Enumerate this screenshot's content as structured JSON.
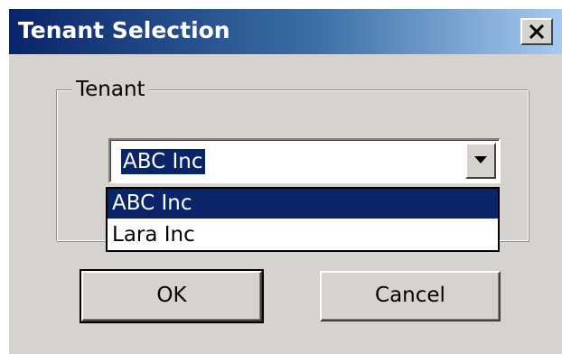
{
  "window": {
    "title": "Tenant Selection",
    "close_label": "close",
    "titlebar_colors": [
      "#0a246a",
      "#a6caf0"
    ],
    "background": "#d6d3ce"
  },
  "group": {
    "legend": "Tenant"
  },
  "combo": {
    "selected_value": "ABC Inc",
    "dropdown_open": true,
    "options": [
      {
        "label": "ABC Inc",
        "highlighted": true
      },
      {
        "label": "Lara Inc",
        "highlighted": false
      }
    ],
    "arrow_icon": "chevron-down-icon"
  },
  "buttons": {
    "ok_label": "OK",
    "cancel_label": "Cancel",
    "default": "OK"
  },
  "colors": {
    "selection": "#0a246a",
    "selection_text": "#ffffff"
  }
}
